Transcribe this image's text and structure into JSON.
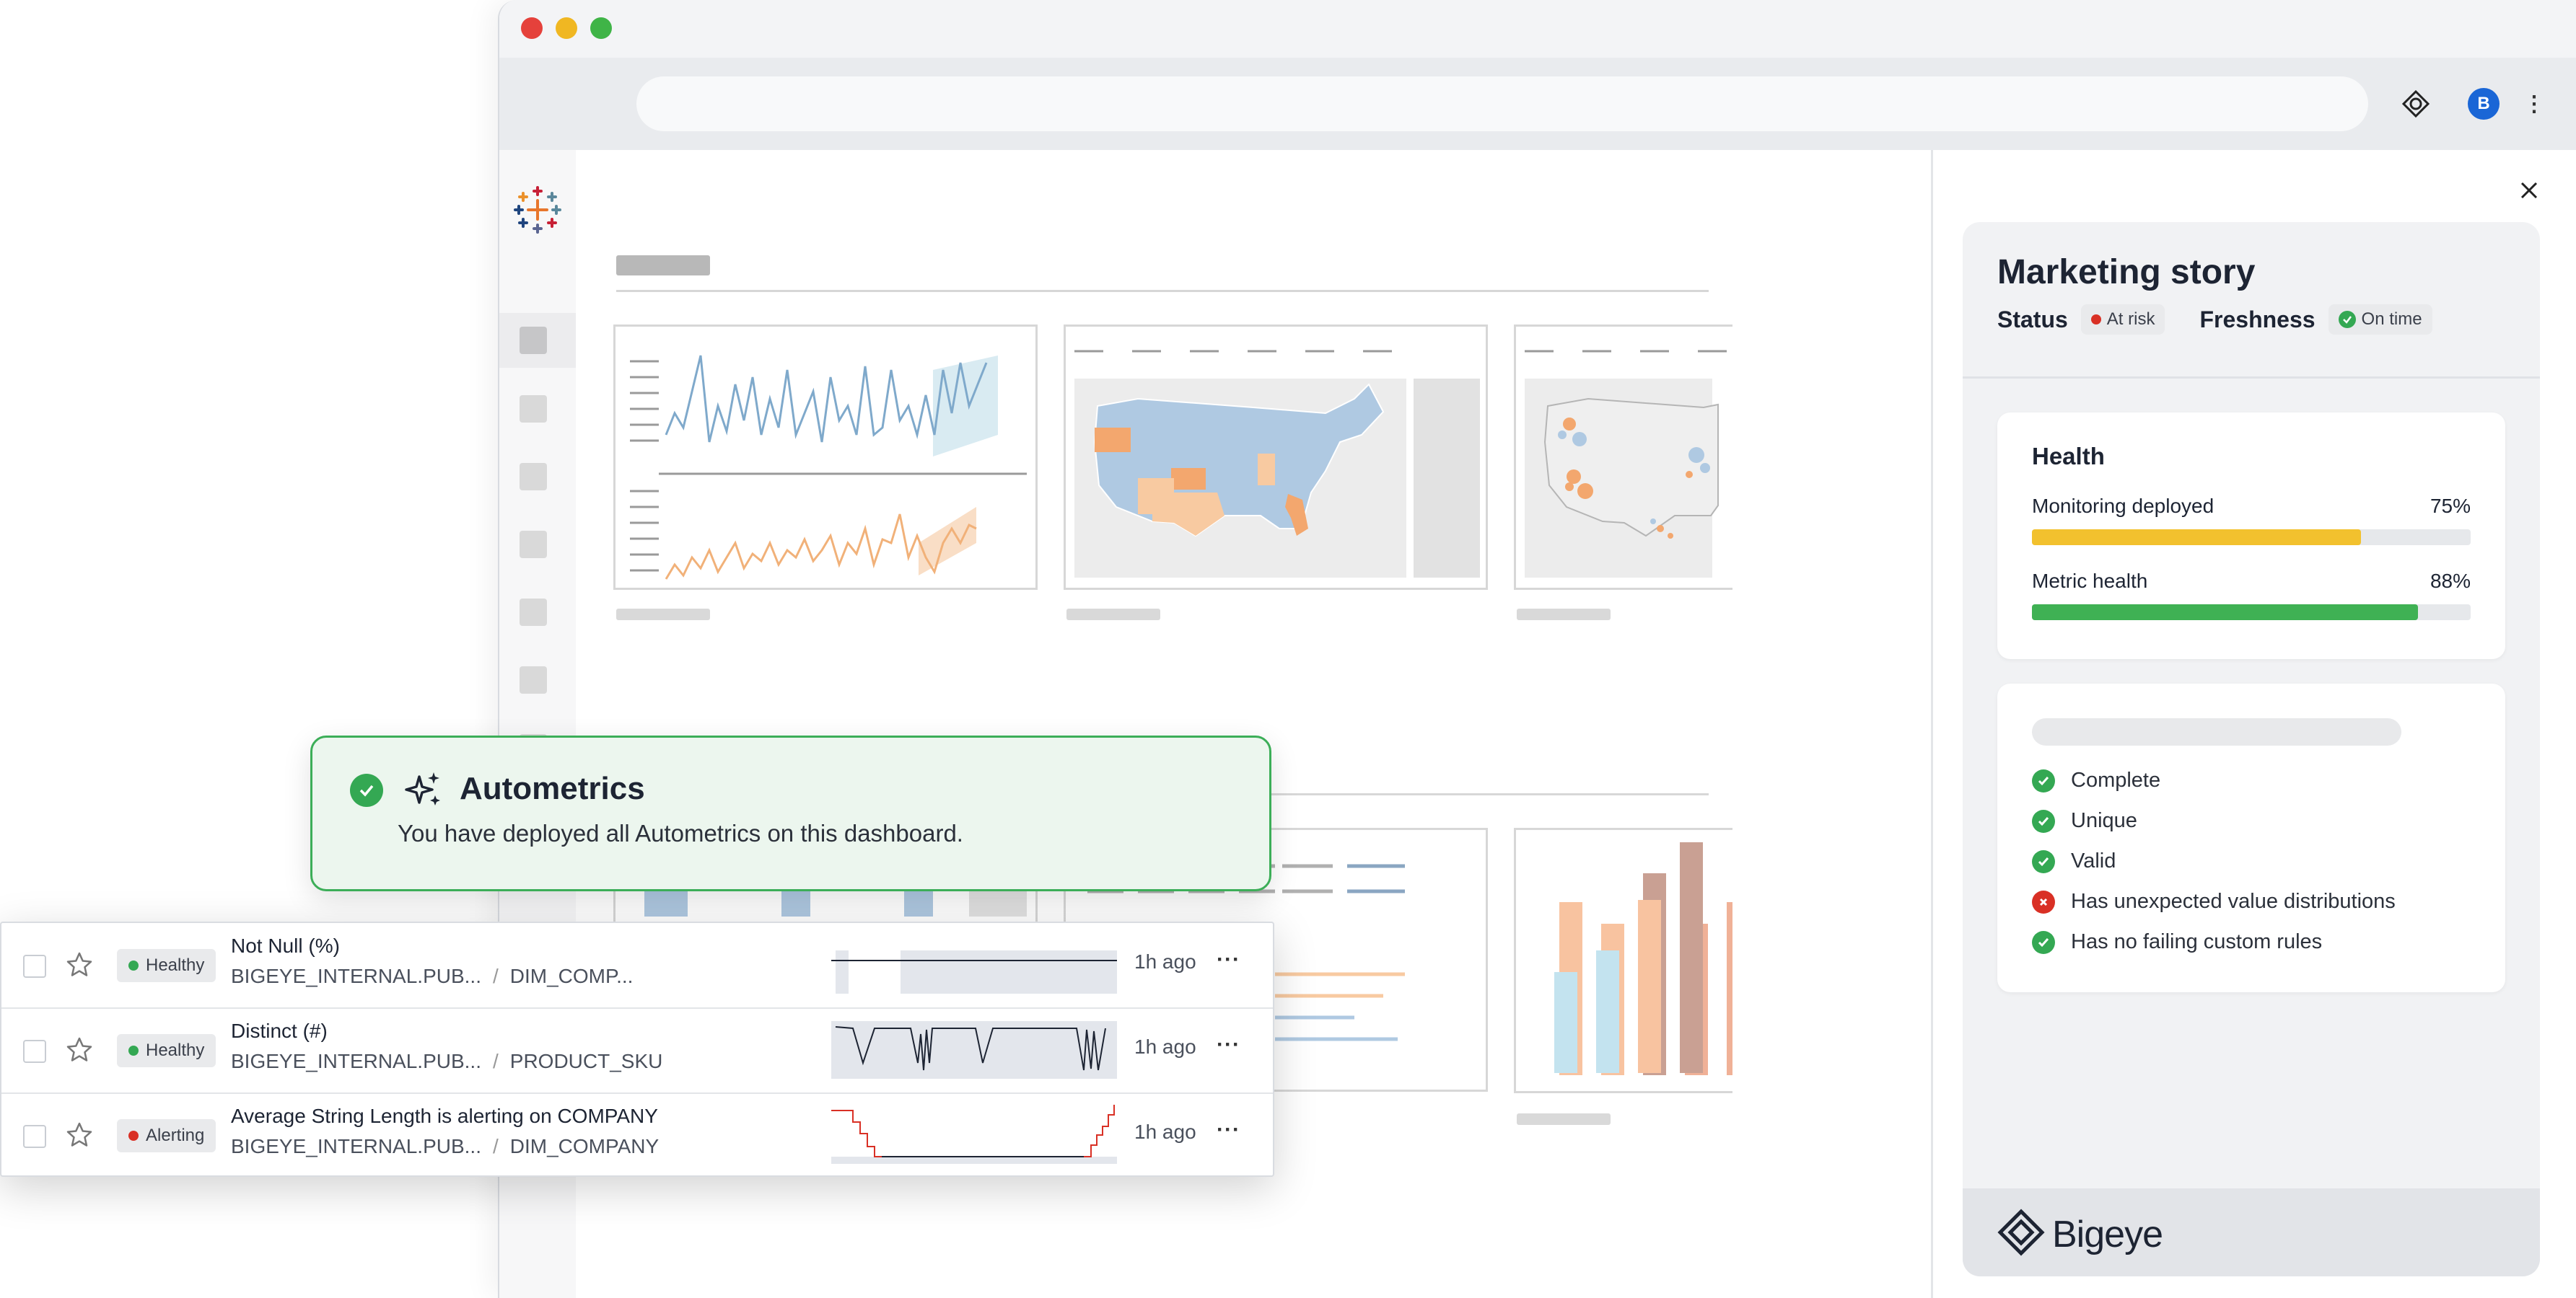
{
  "browser": {
    "avatar_initial": "B"
  },
  "panel": {
    "title": "Marketing story",
    "status_label": "Status",
    "status_value": "At risk",
    "freshness_label": "Freshness",
    "freshness_value": "On time",
    "health": {
      "title": "Health",
      "metrics": [
        {
          "label": "Monitoring deployed",
          "value": "75%",
          "fraction": 0.75,
          "color": "#f2c12e"
        },
        {
          "label": "Metric health",
          "value": "88%",
          "fraction": 0.88,
          "color": "#3fb154"
        }
      ]
    },
    "checks": [
      {
        "label": "Complete",
        "status": "pass"
      },
      {
        "label": "Unique",
        "status": "pass"
      },
      {
        "label": "Valid",
        "status": "pass"
      },
      {
        "label": "Has unexpected value distributions",
        "status": "fail"
      },
      {
        "label": "Has no failing custom rules",
        "status": "pass"
      }
    ],
    "brand": "Bigeye"
  },
  "toast": {
    "title": "Autometrics",
    "message": "You have deployed all Autometrics on this dashboard."
  },
  "metrics": [
    {
      "status": "Healthy",
      "status_color": "#34a853",
      "title": "Not Null (%)",
      "path1": "BIGEYE_INTERNAL.PUB...",
      "sep": "/",
      "path2": "DIM_COMP...",
      "time": "1h ago",
      "more": "···"
    },
    {
      "status": "Healthy",
      "status_color": "#34a853",
      "title": "Distinct (#)",
      "path1": "BIGEYE_INTERNAL.PUB...",
      "sep": "/",
      "path2": "PRODUCT_SKU",
      "time": "1h ago",
      "more": "···"
    },
    {
      "status": "Alerting",
      "status_color": "#d93025",
      "title": "Average String Length is alerting on COMPANY",
      "path1": "BIGEYE_INTERNAL.PUB...",
      "sep": "/",
      "path2": "DIM_COMPANY",
      "time": "1h ago",
      "more": "···"
    }
  ],
  "colors": {
    "healthy": "#34a853",
    "alerting": "#d93025",
    "accent_green": "#3cae58",
    "avatar_blue": "#1a66d6"
  },
  "icons": [
    "search-target-icon",
    "kebab-menu-icon",
    "close-icon",
    "check-circle-icon",
    "error-circle-icon",
    "sparkles-icon",
    "star-icon",
    "bigeye-logo-icon",
    "tableau-logo-icon"
  ]
}
